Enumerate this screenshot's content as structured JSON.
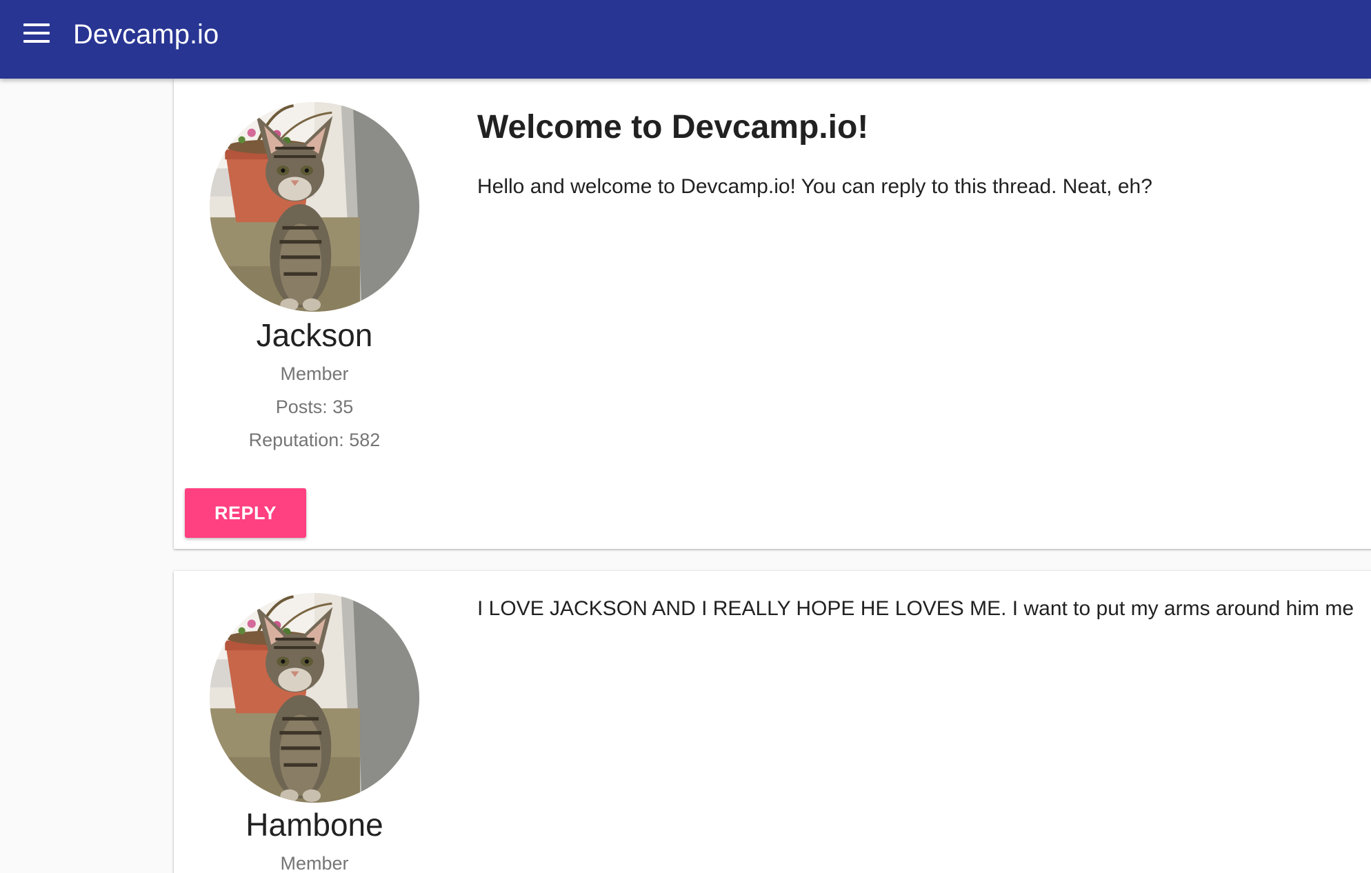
{
  "app": {
    "title": "Devcamp.io",
    "menu_icon": "hamburger-menu-icon",
    "colors": {
      "appbar": "#283593",
      "accent": "#ff4081",
      "background": "#fafafa"
    }
  },
  "posts": [
    {
      "title": "Welcome to Devcamp.io!",
      "body": "Hello and welcome to Devcamp.io! You can reply to this thread. Neat, eh?",
      "author": {
        "name": "Jackson",
        "role": "Member",
        "posts": "Posts: 35",
        "reputation": "Reputation: 582"
      },
      "reply_label": "REPLY"
    },
    {
      "body": "I LOVE JACKSON AND I REALLY HOPE HE LOVES ME. I want to put my arms around him me",
      "author": {
        "name": "Hambone",
        "role": "Member"
      }
    }
  ]
}
